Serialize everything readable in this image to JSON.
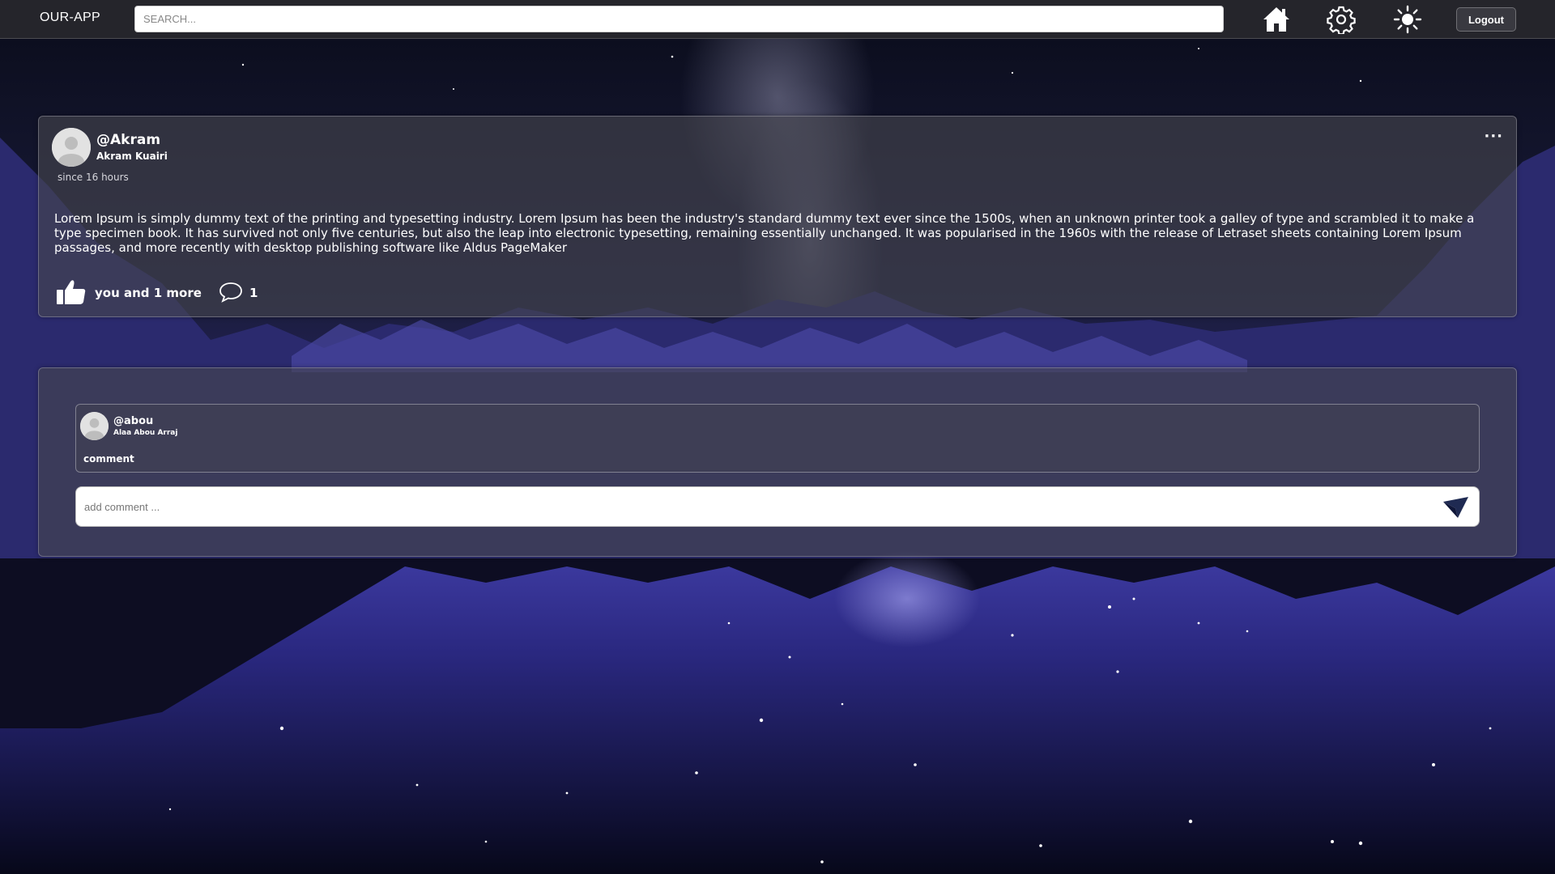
{
  "navbar": {
    "brand": "OUR-APP",
    "search_placeholder": "SEARCH...",
    "icons": [
      "home-icon",
      "settings-gear-icon",
      "theme-sun-icon"
    ],
    "logout_label": "Logout"
  },
  "post": {
    "username": "@Akram",
    "fullname": "Akram Kuairi",
    "time": "since 16 hours",
    "menu": "···",
    "body": "Lorem Ipsum is simply dummy text of the printing and typesetting industry. Lorem Ipsum has been the industry's standard dummy text ever since the 1500s, when an unknown printer took a galley of type and scrambled it to make a type specimen book. It has survived not only five centuries, but also the leap into electronic typesetting, remaining essentially unchanged. It was popularised in the 1960s with the release of Letraset sheets containing Lorem Ipsum passages, and more recently with desktop publishing software like Aldus PageMaker",
    "likes_text": "you and 1 more",
    "comments_count": "1"
  },
  "comments": {
    "items": [
      {
        "username": "@abou",
        "fullname": "Alaa Abou Arraj",
        "text": "comment"
      }
    ],
    "add_placeholder": "add comment ..."
  },
  "colors": {
    "navbar_bg": "#26262c",
    "card_bg": "#46464e",
    "send_icon": "#1f2a52"
  }
}
